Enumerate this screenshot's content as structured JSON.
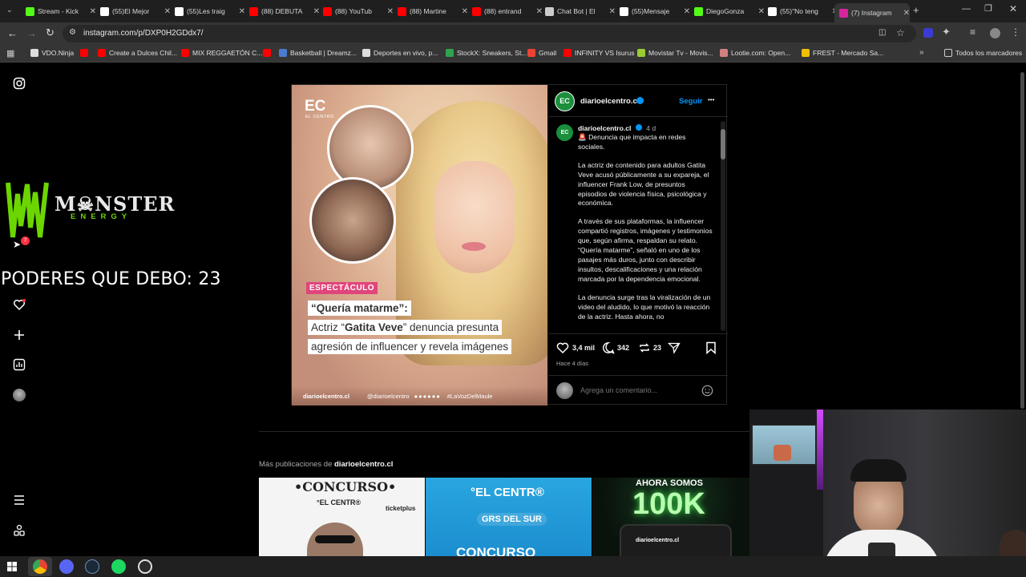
{
  "browser": {
    "tabs": [
      {
        "label": "Stream - Kick",
        "icon": "kick-icon",
        "color": "#53fc18"
      },
      {
        "label": "(55)El Mejor",
        "icon": "tiktok-icon",
        "color": "#ffffff"
      },
      {
        "label": "(55)Les traig",
        "icon": "tiktok-icon",
        "color": "#ffffff"
      },
      {
        "label": "(88) DEBUTA",
        "icon": "youtube-icon",
        "color": "#ff0000"
      },
      {
        "label": "(88) YouTub",
        "icon": "youtube-icon",
        "color": "#ff0000"
      },
      {
        "label": "(88) Martine",
        "icon": "youtube-icon",
        "color": "#ff0000"
      },
      {
        "label": "(88) entrand",
        "icon": "youtube-icon",
        "color": "#ff0000"
      },
      {
        "label": "Chat Bot | El",
        "icon": "shield-icon",
        "color": "#cccccc"
      },
      {
        "label": "(55)Mensaje",
        "icon": "tiktok-icon",
        "color": "#ffffff"
      },
      {
        "label": "DiegoGonza",
        "icon": "kick-icon",
        "color": "#53fc18"
      },
      {
        "label": "(55)\"No teng",
        "icon": "tiktok-icon",
        "color": "#ffffff"
      },
      {
        "label": "(7) Instagram",
        "icon": "instagram-icon",
        "color": "#d6249f"
      }
    ],
    "url": "instagram.com/p/DXP0H2GDdx7/",
    "bookmarks": [
      {
        "label": "VDO.Ninja",
        "color": "#dddddd"
      },
      {
        "label": "",
        "color": "#ff0000"
      },
      {
        "label": "Create a Dulces Chil...",
        "color": "#ff0000"
      },
      {
        "label": "MIX REGGAETÓN C...",
        "color": "#ff0000"
      },
      {
        "label": "",
        "color": "#ff0000"
      },
      {
        "label": "Basketball | Dreamz...",
        "color": "#4a7bd0"
      },
      {
        "label": "Deportes en vivo, p...",
        "color": "#dddddd"
      },
      {
        "label": "StockX: Sneakers, St...",
        "color": "#2ea44f"
      },
      {
        "label": "Gmail",
        "color": "#ea4335"
      },
      {
        "label": "INFINITY VS Isurus",
        "color": "#ff0000"
      },
      {
        "label": "Movistar Tv - Movis...",
        "color": "#9acd32"
      },
      {
        "label": "Lootie.com: Open...",
        "color": "#d08080"
      },
      {
        "label": "FREST - Mercado Sa...",
        "color": "#f0c000"
      }
    ],
    "all_bookmarks": "Todos los marcadores"
  },
  "overlay": {
    "brand_main": "M☠NSTER",
    "brand_sub": "ENERGY",
    "counter_text": "PODERES QUE DEBO: 23",
    "notif_badge": "7"
  },
  "post": {
    "account": "diarioelcentro.cl",
    "follow_label": "Seguir",
    "more_label": "•••",
    "time_short": "4 d",
    "caption": [
      "🚨 Denuncia que impacta en redes sociales.",
      "La actriz de contenido para adultos Gatita Veve acusó públicamente a su expareja, el influencer Frank Low, de presuntos episodios de violencia física, psicológica y económica.",
      "A través de sus plataformas, la influencer compartió registros, imágenes y testimonios que, según afirma, respaldan su relato. “Quería matarme”, señaló en uno de los pasajes más duros, junto con describir insultos, descalificaciones y una relación marcada por la dependencia emocional.",
      "La denuncia surge tras la viralización de un video del aludido, lo que motivó la reacción de la actriz. Hasta ahora, no"
    ],
    "likes": "3,4 mil",
    "comments": "342",
    "reposts": "23",
    "time_long": "Hace 4 días",
    "comment_placeholder": "Agrega un comentario...",
    "image": {
      "logo": "EC",
      "logo_sub": "EL CENTRO",
      "tag": "ESPECTÁCULO",
      "headline_1": "“Quería matarme”:",
      "headline_2_pre": "Actriz “",
      "headline_2_name": "Gatita Veve",
      "headline_2_post": "” denuncia presunta",
      "headline_3": "agresión de influencer y revela imágenes",
      "footer_site": "diarioelcentro.cl",
      "footer_handle": "@diarioelcentro",
      "footer_tag": "#LaVozDelMaule"
    }
  },
  "more": {
    "title_pre": "Más publicaciones de ",
    "title_account": "diarioelcentro.cl",
    "thumbs": [
      {
        "headline": "•CONCURSO•",
        "sub": "°EL CENTR®",
        "extra": "ticketplus"
      },
      {
        "headline": "°EL CENTR®",
        "sub": "GRS DEL SUR",
        "extra": "CONCURSO"
      },
      {
        "headline": "AHORA SOMOS",
        "sub": "100K",
        "extra": "diarioelcentro.cl"
      }
    ]
  },
  "colors": {
    "accent_blue": "#0095f6",
    "ec_green": "#1a8f3c",
    "tag_pink": "#e0457b",
    "monster_green": "#6bd600"
  }
}
